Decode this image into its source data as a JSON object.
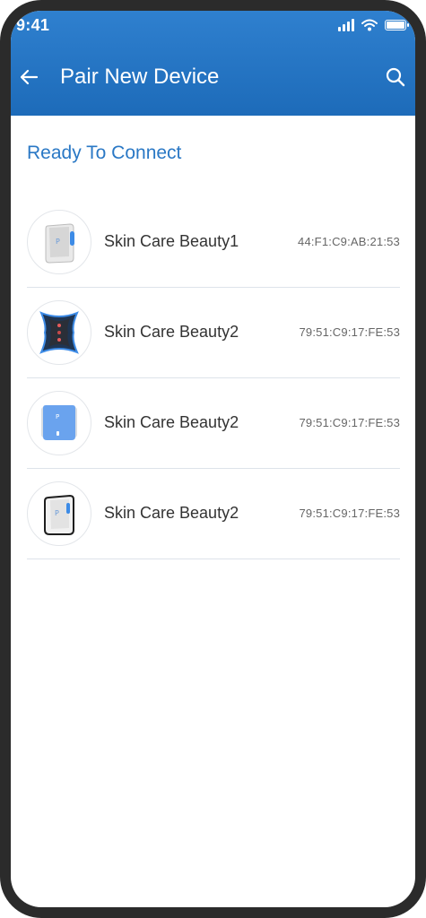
{
  "status_bar": {
    "time": "9:41"
  },
  "header": {
    "title": "Pair New Device"
  },
  "section": {
    "title": "Ready To Connect"
  },
  "devices": [
    {
      "name": "Skin Care Beauty1",
      "mac": "44:F1:C9:AB:21:53",
      "image": "white-beauty-device"
    },
    {
      "name": "Skin Care Beauty2",
      "mac": "79:51:C9:17:FE:53",
      "image": "dark-blue-beauty-device"
    },
    {
      "name": "Skin Care Beauty2",
      "mac": "79:51:C9:17:FE:53",
      "image": "blue-beauty-device"
    },
    {
      "name": "Skin Care Beauty2",
      "mac": "79:51:C9:17:FE:53",
      "image": "white-black-beauty-device"
    }
  ],
  "colors": {
    "header": "#1d6bb9",
    "accent": "#2a78c5",
    "frame": "#2b2b2b"
  }
}
